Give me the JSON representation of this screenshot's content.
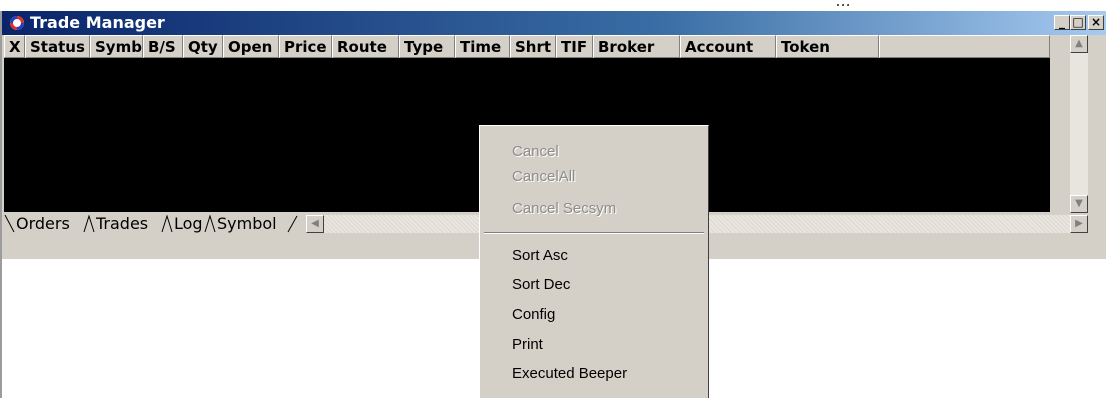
{
  "window": {
    "title": "Trade Manager",
    "buttons": {
      "minimize": "_",
      "maximize": "□",
      "close": "×"
    }
  },
  "top_strip_text": "...",
  "columns": [
    "X",
    "Status",
    "Symb",
    "B/S",
    "Qty",
    "Open",
    "Price",
    "Route",
    "Type",
    "Time",
    "Shrt",
    "TIF",
    "Broker",
    "Account",
    "Token"
  ],
  "tabs": [
    {
      "label": "Orders",
      "active": true
    },
    {
      "label": "Trades",
      "active": false
    },
    {
      "label": "Log",
      "active": false
    },
    {
      "label": "Symbol",
      "active": false
    }
  ],
  "context_menu": {
    "disabled_items": [
      "Cancel",
      "CancelAll",
      "Cancel Secsym"
    ],
    "enabled_items": [
      "Sort Asc",
      "Sort Dec",
      "Config",
      "Print",
      "Executed Beeper"
    ]
  },
  "scroll_glyphs": {
    "up": "▲",
    "down": "▼",
    "left": "◀",
    "right": "▶"
  },
  "colors": {
    "titlebar_start": "#0a246a",
    "titlebar_end": "#a6caf0",
    "grid_background": "#000000",
    "face": "#d4d0c8"
  }
}
